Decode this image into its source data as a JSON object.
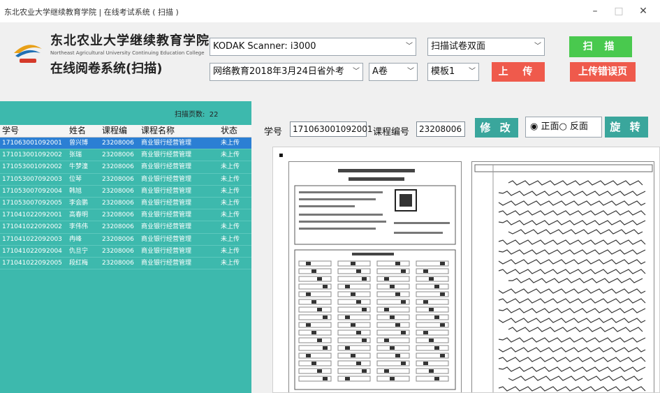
{
  "window": {
    "title": "东北农业大学继续教育学院 | 在线考试系统 ( 扫描 )",
    "minimize": "–",
    "maximize": "□",
    "close": "✕"
  },
  "brand": {
    "name_cn": "东北农业大学继续教育学院",
    "name_en": "Northeast Agricultural University Continuing Education College",
    "system_name": "在线阅卷系统(扫描)"
  },
  "toolbar": {
    "scanner": "KODAK Scanner: i3000",
    "scan_mode": "扫描试卷双面",
    "scan_button": "扫 描",
    "exam": "网络教育2018年3月24日省外考",
    "paper": "A卷",
    "template": "模板1",
    "upload_button": "上 传",
    "upload_error_button": "上传错误页"
  },
  "list": {
    "page_count_label": "扫描页数:",
    "page_count": "22",
    "columns": [
      "学号",
      "姓名",
      "课程编",
      "课程名称",
      "状态"
    ],
    "rows": [
      [
        "171063001092001",
        "曾兴博",
        "23208006",
        "商业银行经营管理",
        "未上传"
      ],
      [
        "171013001092002",
        "张瑞",
        "23208006",
        "商业银行经营管理",
        "未上传"
      ],
      [
        "171053001092002",
        "牛梦潼",
        "23208006",
        "商业银行经营管理",
        "未上传"
      ],
      [
        "171053007092003",
        "位琴",
        "23208006",
        "商业银行经营管理",
        "未上传"
      ],
      [
        "171053007092004",
        "韩旭",
        "23208006",
        "商业银行经营管理",
        "未上传"
      ],
      [
        "171053007092005",
        "李会鹏",
        "23208006",
        "商业银行经营管理",
        "未上传"
      ],
      [
        "171041022092001",
        "高春明",
        "23208006",
        "商业银行经营管理",
        "未上传"
      ],
      [
        "171041022092002",
        "李伟伟",
        "23208006",
        "商业银行经营管理",
        "未上传"
      ],
      [
        "171041022092003",
        "冉峰",
        "23208006",
        "商业银行经营管理",
        "未上传"
      ],
      [
        "171041022092004",
        "仇旦宁",
        "23208006",
        "商业银行经营管理",
        "未上传"
      ],
      [
        "171041022092005",
        "段红梅",
        "23208006",
        "商业银行经营管理",
        "未上传"
      ]
    ]
  },
  "detail": {
    "student_id_label": "学号",
    "student_id": "171063001092001",
    "course_code_label": "课程编号",
    "course_code": "23208006",
    "edit_button": "修 改",
    "front_label": "正面",
    "back_label": "反面",
    "rotate_button": "旋 转"
  },
  "colors": {
    "panel_teal": "#3db9ad",
    "selected_row": "#2b7fd4",
    "green_button": "#49c94e",
    "red_button": "#ef5a4c",
    "teal_button": "#3aa69c"
  }
}
